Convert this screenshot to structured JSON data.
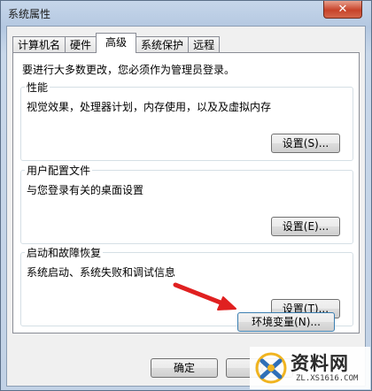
{
  "window": {
    "title": "系统属性",
    "close_glyph": "✕"
  },
  "tabs": [
    {
      "label": "计算机名",
      "active": false
    },
    {
      "label": "硬件",
      "active": false
    },
    {
      "label": "高级",
      "active": true
    },
    {
      "label": "系统保护",
      "active": false
    },
    {
      "label": "远程",
      "active": false
    }
  ],
  "panel": {
    "intro": "要进行大多数更改，您必须作为管理员登录。",
    "performance": {
      "legend": "性能",
      "description": "视觉效果，处理器计划，内存使用，以及及虚拟内存",
      "button": "设置(S)..."
    },
    "user_profiles": {
      "legend": "用户配置文件",
      "description": "与您登录有关的桌面设置",
      "button": "设置(E)..."
    },
    "startup_recovery": {
      "legend": "启动和故障恢复",
      "description": "系统启动、系统失败和调试信息",
      "button": "设置(T)..."
    },
    "env_button": "环境变量(N)..."
  },
  "footer": {
    "ok": "确定",
    "cancel": "取"
  },
  "watermark": {
    "title": "资料网",
    "url": "ZL.XS1616.COM"
  },
  "colors": {
    "arrow": "#e02020",
    "close_button": "#c7432a",
    "titlebar": "#b4c8e1"
  },
  "icons": [
    "close-icon",
    "red-arrow-annotation",
    "watermark-logo-icon"
  ]
}
